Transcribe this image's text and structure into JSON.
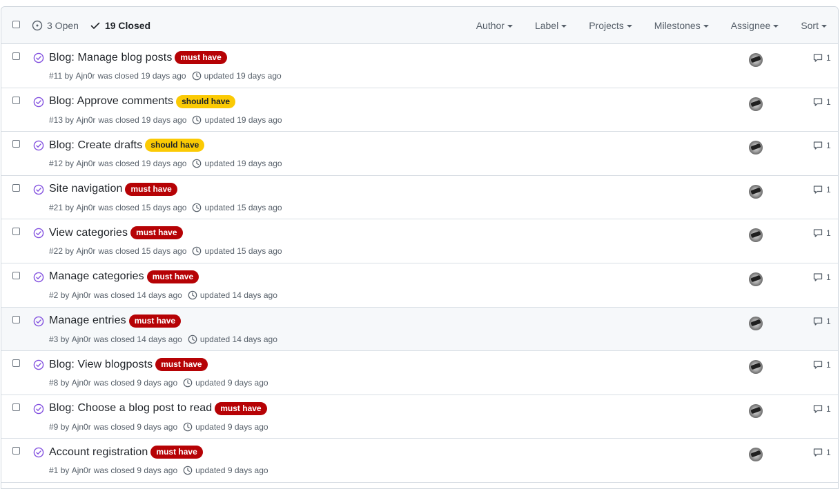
{
  "header": {
    "open_label": "3 Open",
    "closed_label": "19 Closed",
    "filters": [
      "Author",
      "Label",
      "Projects",
      "Milestones",
      "Assignee",
      "Sort"
    ]
  },
  "colors": {
    "must_have": "#b60205",
    "should_have": "#fbca04",
    "closed_icon": "#8250df"
  },
  "issues": [
    {
      "title": "Blog: Manage blog posts",
      "label": "must have",
      "label_type": "must",
      "number": "#11",
      "author": "Ajn0r",
      "closed": "was closed 19 days ago",
      "updated": "updated 19 days ago",
      "comments": "1"
    },
    {
      "title": "Blog: Approve comments",
      "label": "should have",
      "label_type": "should",
      "number": "#13",
      "author": "Ajn0r",
      "closed": "was closed 19 days ago",
      "updated": "updated 19 days ago",
      "comments": "1"
    },
    {
      "title": "Blog: Create drafts",
      "label": "should have",
      "label_type": "should",
      "number": "#12",
      "author": "Ajn0r",
      "closed": "was closed 19 days ago",
      "updated": "updated 19 days ago",
      "comments": "1"
    },
    {
      "title": "Site navigation",
      "label": "must have",
      "label_type": "must",
      "number": "#21",
      "author": "Ajn0r",
      "closed": "was closed 15 days ago",
      "updated": "updated 15 days ago",
      "comments": "1"
    },
    {
      "title": "View categories",
      "label": "must have",
      "label_type": "must",
      "number": "#22",
      "author": "Ajn0r",
      "closed": "was closed 15 days ago",
      "updated": "updated 15 days ago",
      "comments": "1"
    },
    {
      "title": "Manage categories",
      "label": "must have",
      "label_type": "must",
      "number": "#2",
      "author": "Ajn0r",
      "closed": "was closed 14 days ago",
      "updated": "updated 14 days ago",
      "comments": "1"
    },
    {
      "title": "Manage entries",
      "label": "must have",
      "label_type": "must",
      "number": "#3",
      "author": "Ajn0r",
      "closed": "was closed 14 days ago",
      "updated": "updated 14 days ago",
      "comments": "1"
    },
    {
      "title": "Blog: View blogposts",
      "label": "must have",
      "label_type": "must",
      "number": "#8",
      "author": "Ajn0r",
      "closed": "was closed 9 days ago",
      "updated": "updated 9 days ago",
      "comments": "1"
    },
    {
      "title": "Blog: Choose a blog post to read",
      "label": "must have",
      "label_type": "must",
      "number": "#9",
      "author": "Ajn0r",
      "closed": "was closed 9 days ago",
      "updated": "updated 9 days ago",
      "comments": "1"
    },
    {
      "title": "Account registration",
      "label": "must have",
      "label_type": "must",
      "number": "#1",
      "author": "Ajn0r",
      "closed": "was closed 9 days ago",
      "updated": "updated 9 days ago",
      "comments": "1"
    }
  ]
}
